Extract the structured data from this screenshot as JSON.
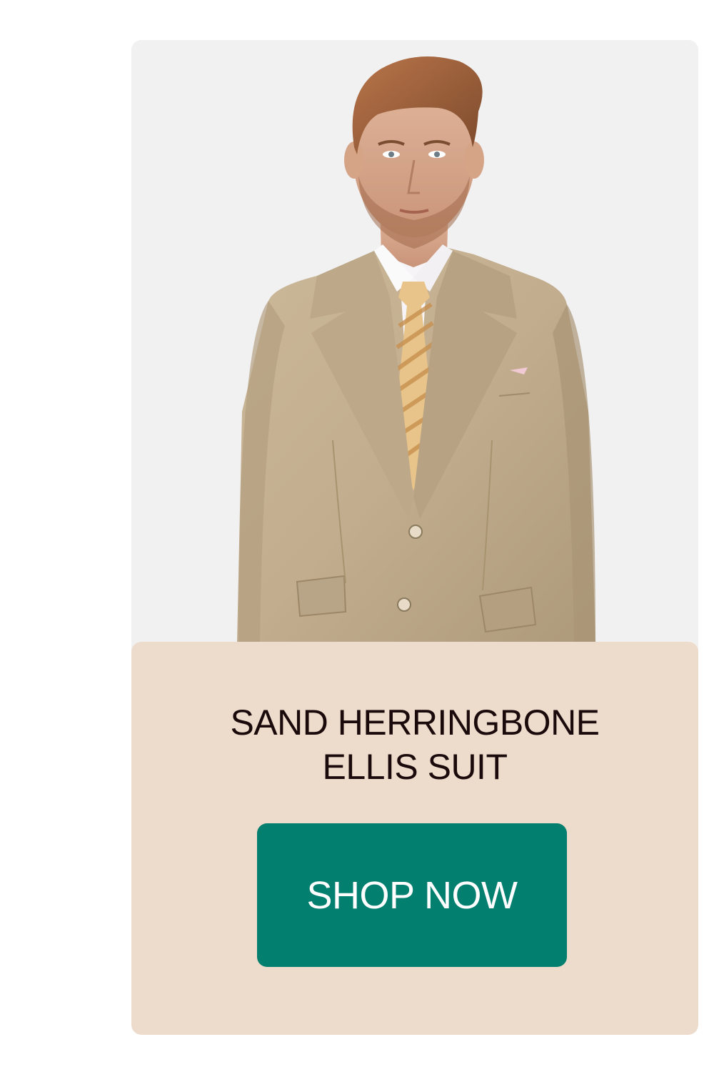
{
  "product": {
    "image_alt": "Man wearing a sand herringbone two-button suit with white shirt and gold striped tie",
    "title_line1": "SAND HERRINGBONE",
    "title_line2": "ELLIS SUIT",
    "cta_label": "SHOP NOW"
  },
  "colors": {
    "photo_bg": "#f1f1f2",
    "info_bg": "#eddccb",
    "title_text": "#1a0a0c",
    "cta_bg": "#037f6f",
    "cta_text": "#ffffff"
  }
}
